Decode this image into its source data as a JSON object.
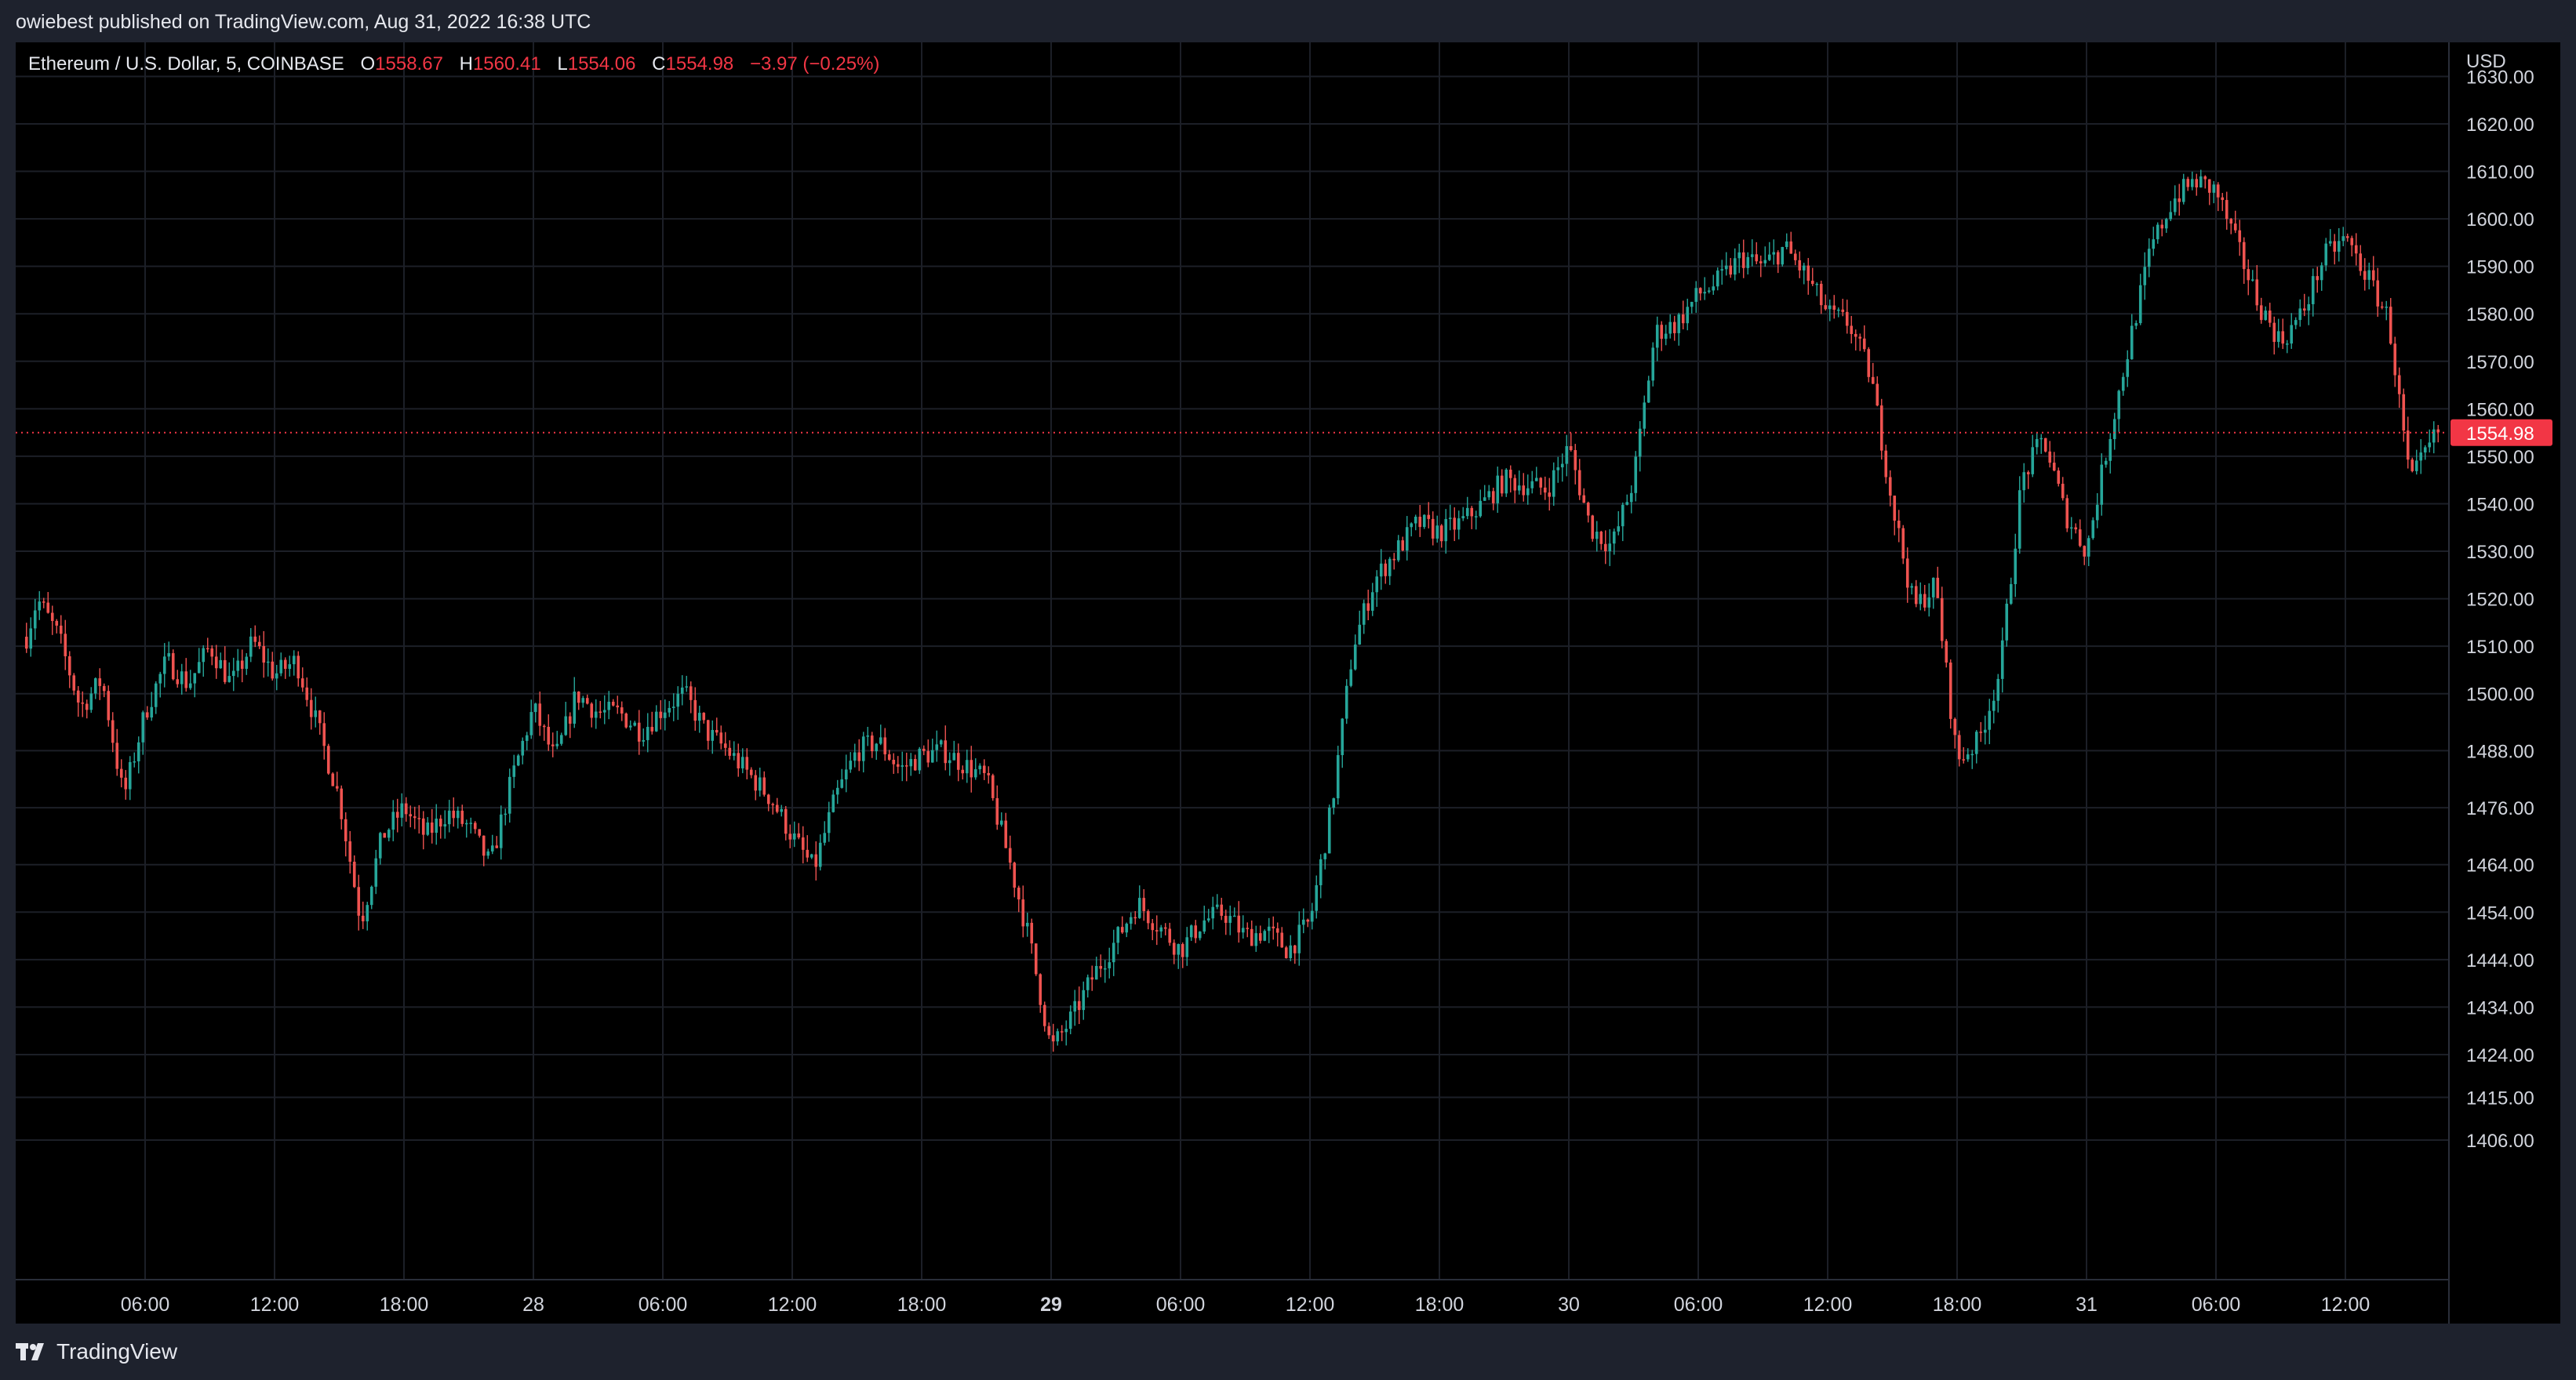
{
  "header": {
    "attribution": "owiebest published on TradingView.com, Aug 31, 2022 16:38 UTC"
  },
  "legend": {
    "symbol": "Ethereum / U.S. Dollar, 5, COINBASE",
    "open_label": "O",
    "open": "1558.67",
    "high_label": "H",
    "high": "1560.41",
    "low_label": "L",
    "low": "1554.06",
    "close_label": "C",
    "close": "1554.98",
    "change": "−3.97 (−0.25%)"
  },
  "footer": {
    "brand": "TradingView"
  },
  "colors": {
    "up": "#26a69a",
    "down": "#ef5350",
    "background": "#000000",
    "frame": "#1e222d",
    "grid": "#1c1f27",
    "last_price_bg": "#f23645",
    "text": "#d1d4dc"
  },
  "chart_data": {
    "type": "candlestick",
    "currency": "USD",
    "interval": "5",
    "exchange": "COINBASE",
    "grid": true,
    "ylim": [
      1400,
      1636
    ],
    "yticks": [
      "1630.00",
      "1620.00",
      "1610.00",
      "1600.00",
      "1590.00",
      "1580.00",
      "1570.00",
      "1560.00",
      "1550.00",
      "1540.00",
      "1530.00",
      "1520.00",
      "1510.00",
      "1500.00",
      "1488.00",
      "1476.00",
      "1464.00",
      "1454.00",
      "1444.00",
      "1434.00",
      "1424.00",
      "1415.00",
      "1406.00"
    ],
    "xticks": [
      {
        "label": "06:00",
        "t": 6,
        "bold": false
      },
      {
        "label": "12:00",
        "t": 12,
        "bold": false
      },
      {
        "label": "18:00",
        "t": 18,
        "bold": false
      },
      {
        "label": "28",
        "t": 24,
        "bold": false
      },
      {
        "label": "06:00",
        "t": 30,
        "bold": false
      },
      {
        "label": "12:00",
        "t": 36,
        "bold": false
      },
      {
        "label": "18:00",
        "t": 42,
        "bold": false
      },
      {
        "label": "29",
        "t": 48,
        "bold": true
      },
      {
        "label": "06:00",
        "t": 54,
        "bold": false
      },
      {
        "label": "12:00",
        "t": 60,
        "bold": false
      },
      {
        "label": "18:00",
        "t": 66,
        "bold": false
      },
      {
        "label": "30",
        "t": 72,
        "bold": false
      },
      {
        "label": "06:00",
        "t": 78,
        "bold": false
      },
      {
        "label": "12:00",
        "t": 84,
        "bold": false
      },
      {
        "label": "18:00",
        "t": 90,
        "bold": false
      },
      {
        "label": "31",
        "t": 96,
        "bold": false
      },
      {
        "label": "06:00",
        "t": 102,
        "bold": false
      },
      {
        "label": "12:00",
        "t": 108,
        "bold": false
      }
    ],
    "price_path": [
      [
        0.5,
        1512
      ],
      [
        1,
        1520
      ],
      [
        2,
        1512
      ],
      [
        3,
        1497
      ],
      [
        4,
        1503
      ],
      [
        5,
        1478
      ],
      [
        6,
        1496
      ],
      [
        7,
        1507
      ],
      [
        8,
        1502
      ],
      [
        9,
        1510
      ],
      [
        10,
        1502
      ],
      [
        11,
        1511
      ],
      [
        12,
        1504
      ],
      [
        13,
        1507
      ],
      [
        14,
        1493
      ],
      [
        15,
        1478
      ],
      [
        16,
        1452
      ],
      [
        17,
        1470
      ],
      [
        18,
        1476
      ],
      [
        19,
        1470
      ],
      [
        20,
        1475
      ],
      [
        21,
        1472
      ],
      [
        22,
        1464
      ],
      [
        23,
        1482
      ],
      [
        24,
        1497
      ],
      [
        25,
        1486
      ],
      [
        26,
        1500
      ],
      [
        27,
        1496
      ],
      [
        28,
        1496
      ],
      [
        29,
        1492
      ],
      [
        30,
        1497
      ],
      [
        31,
        1500
      ],
      [
        32,
        1492
      ],
      [
        33,
        1488
      ],
      [
        34,
        1483
      ],
      [
        35,
        1478
      ],
      [
        36,
        1470
      ],
      [
        37,
        1463
      ],
      [
        38,
        1478
      ],
      [
        39,
        1488
      ],
      [
        40,
        1490
      ],
      [
        41,
        1484
      ],
      [
        42,
        1487
      ],
      [
        43,
        1488
      ],
      [
        44,
        1485
      ],
      [
        45,
        1482
      ],
      [
        46,
        1466
      ],
      [
        47,
        1448
      ],
      [
        48,
        1425
      ],
      [
        49,
        1432
      ],
      [
        50,
        1441
      ],
      [
        51,
        1448
      ],
      [
        52,
        1456
      ],
      [
        53,
        1451
      ],
      [
        54,
        1446
      ],
      [
        55,
        1452
      ],
      [
        56,
        1454
      ],
      [
        57,
        1449
      ],
      [
        58,
        1450
      ],
      [
        59,
        1446
      ],
      [
        60,
        1452
      ],
      [
        61,
        1476
      ],
      [
        62,
        1510
      ],
      [
        63,
        1524
      ],
      [
        64,
        1530
      ],
      [
        65,
        1536
      ],
      [
        66,
        1534
      ],
      [
        67,
        1536
      ],
      [
        68,
        1540
      ],
      [
        69,
        1545
      ],
      [
        70,
        1544
      ],
      [
        71,
        1543
      ],
      [
        72,
        1552
      ],
      [
        73,
        1535
      ],
      [
        74,
        1531
      ],
      [
        75,
        1545
      ],
      [
        76,
        1576
      ],
      [
        77,
        1578
      ],
      [
        78,
        1584
      ],
      [
        79,
        1587
      ],
      [
        80,
        1592
      ],
      [
        81,
        1590
      ],
      [
        82,
        1594
      ],
      [
        83,
        1588
      ],
      [
        84,
        1580
      ],
      [
        85,
        1578
      ],
      [
        86,
        1567
      ],
      [
        87,
        1540
      ],
      [
        88,
        1518
      ],
      [
        89,
        1523
      ],
      [
        90,
        1486
      ],
      [
        91,
        1490
      ],
      [
        92,
        1505
      ],
      [
        93,
        1545
      ],
      [
        94,
        1554
      ],
      [
        95,
        1538
      ],
      [
        96,
        1530
      ],
      [
        97,
        1553
      ],
      [
        98,
        1574
      ],
      [
        99,
        1594
      ],
      [
        100,
        1604
      ],
      [
        101,
        1608
      ],
      [
        102,
        1606
      ],
      [
        103,
        1594
      ],
      [
        104,
        1582
      ],
      [
        105,
        1574
      ],
      [
        106,
        1580
      ],
      [
        107,
        1592
      ],
      [
        108,
        1596
      ],
      [
        109,
        1588
      ],
      [
        110,
        1579
      ],
      [
        111,
        1544
      ],
      [
        112,
        1553
      ],
      [
        112.3,
        1554.98
      ]
    ],
    "last_price": "1554.98"
  }
}
